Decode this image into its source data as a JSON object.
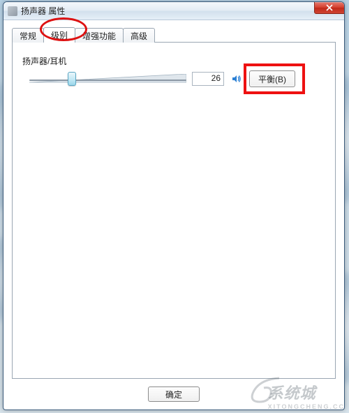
{
  "window": {
    "title": "扬声器 属性",
    "close_label": "X"
  },
  "tabs": [
    {
      "label": "常规"
    },
    {
      "label": "级别"
    },
    {
      "label": "增强功能"
    },
    {
      "label": "高级"
    }
  ],
  "active_tab_index": 1,
  "level": {
    "group_label": "扬声器/耳机",
    "value": "26",
    "slider_percent": 26,
    "mute_icon": "speaker-on-icon",
    "balance_label": "平衡(B)"
  },
  "footer": {
    "ok_label": "确定"
  },
  "watermark": {
    "brand": "系统城",
    "url": "XITONGCHENG.CC"
  },
  "colors": {
    "annotation": "#e01010",
    "accent": "#2a7fd4"
  }
}
